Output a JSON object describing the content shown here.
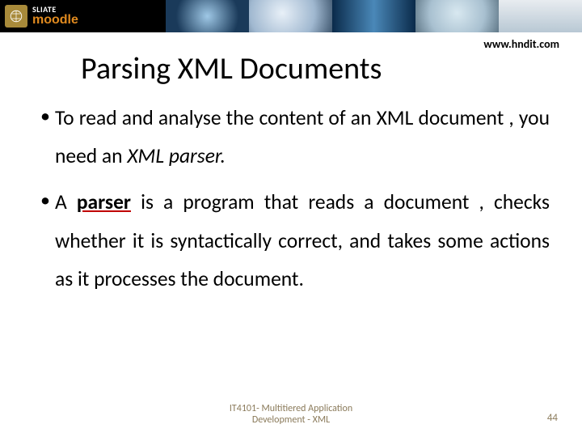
{
  "banner": {
    "logo_line1": "SLIATE",
    "logo_line2": "moodle"
  },
  "url": "www.hndit.com",
  "title": "Parsing XML Documents",
  "bullets": [
    {
      "pre": "To read and analyse the content of an XML document , you need an ",
      "em": "XML parser.",
      "post": ""
    },
    {
      "pre": "A ",
      "strong": "parser",
      "post": " is a program that reads a document , checks whether it is syntactically correct, and takes some actions as it processes the document."
    }
  ],
  "footer": {
    "course_line1": "IT4101- Multitiered Application",
    "course_line2": "Development - XML",
    "page": "44"
  }
}
